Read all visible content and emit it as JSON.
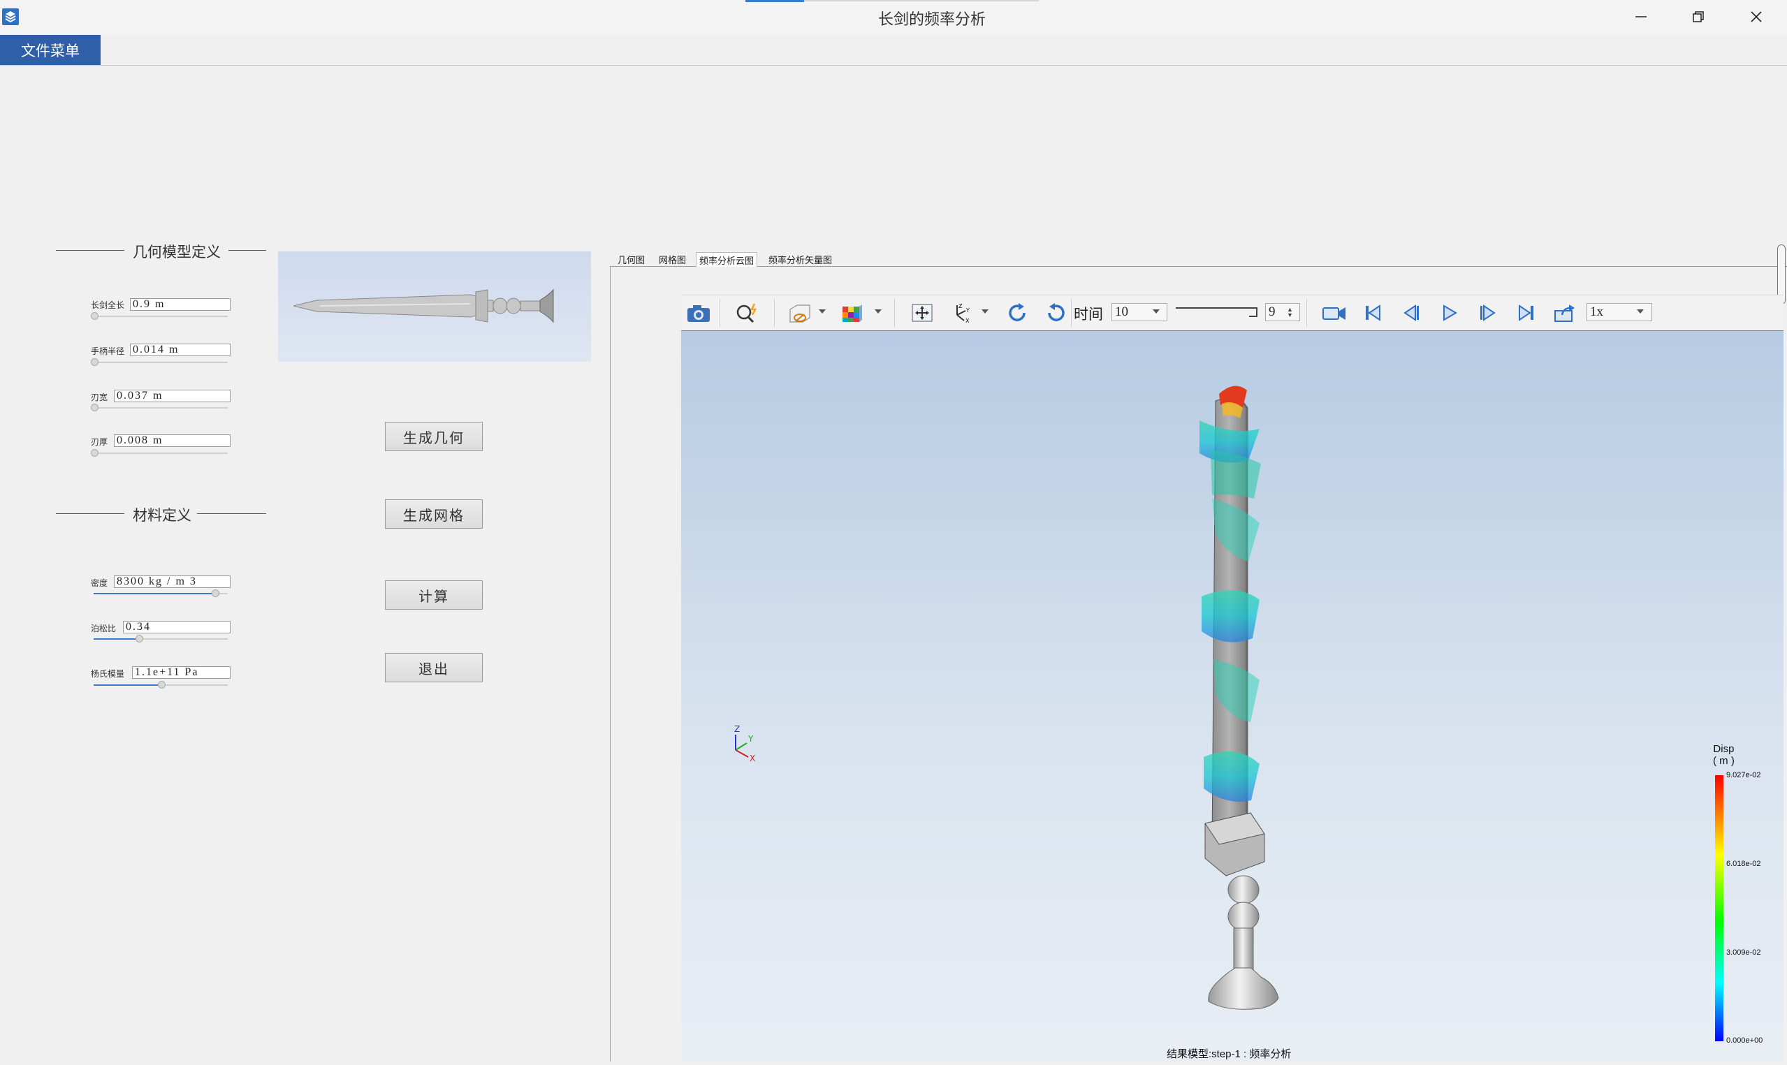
{
  "window": {
    "title": "长剑的频率分析",
    "icon": "app-cube-icon",
    "controls": [
      "minimize-icon",
      "restore-icon",
      "close-icon"
    ]
  },
  "menu": {
    "file_menu_label": "文件菜单"
  },
  "geometry": {
    "heading": "几何模型定义",
    "params": [
      {
        "label": "长剑全长",
        "value": "0.9 m",
        "slider": 0.0
      },
      {
        "label": "手柄半径",
        "value": "0.014 m",
        "slider": 0.0
      },
      {
        "label": "刃宽",
        "value": "0.037 m",
        "slider": 0.0
      },
      {
        "label": "刃厚",
        "value": "0.008 m",
        "slider": 0.0
      }
    ]
  },
  "material": {
    "heading": "材料定义",
    "params": [
      {
        "label": "密度",
        "value": "8300 kg / m  3",
        "slider": 0.9
      },
      {
        "label": "泊松比",
        "value": "0.34",
        "slider": 0.34
      },
      {
        "label": "杨氏模量",
        "value": "1.1e+11 Pa",
        "slider": 0.5
      }
    ]
  },
  "actions": {
    "generate_geometry": "生成几何",
    "generate_mesh": "生成网格",
    "compute": "计算",
    "exit": "退出"
  },
  "tabs": [
    {
      "label": "几何图",
      "active": false
    },
    {
      "label": "网格图",
      "active": false
    },
    {
      "label": "频率分析云图",
      "active": true
    },
    {
      "label": "频率分析矢量图",
      "active": false
    }
  ],
  "toolbar": {
    "time_label": "时间",
    "time_value": "10",
    "frame_value": "9",
    "speed_value": "1x",
    "icons": [
      "camera-icon",
      "zoom-magic-icon",
      "clip-box-icon",
      "color-cube-icon",
      "fit-view-icon",
      "axes-orient-icon",
      "rotate-cw-icon",
      "rotate-ccw-icon",
      "record-icon",
      "first-frame-icon",
      "prev-frame-icon",
      "play-icon",
      "next-frame-icon",
      "last-frame-icon",
      "export-icon"
    ]
  },
  "legend": {
    "title_line1": "Disp",
    "title_line2": "( m )",
    "max": "9.027e-02",
    "mid_high": "6.018e-02",
    "mid_low": "3.009e-02",
    "min": "0.000e+00",
    "colors": [
      "#ff0000",
      "#ffff00",
      "#00ff00",
      "#00ffff",
      "#0000ff"
    ]
  },
  "axes_triad": {
    "x": "X",
    "y": "Y",
    "z": "Z"
  },
  "result_label": "结果模型:step-1 : 频率分析"
}
